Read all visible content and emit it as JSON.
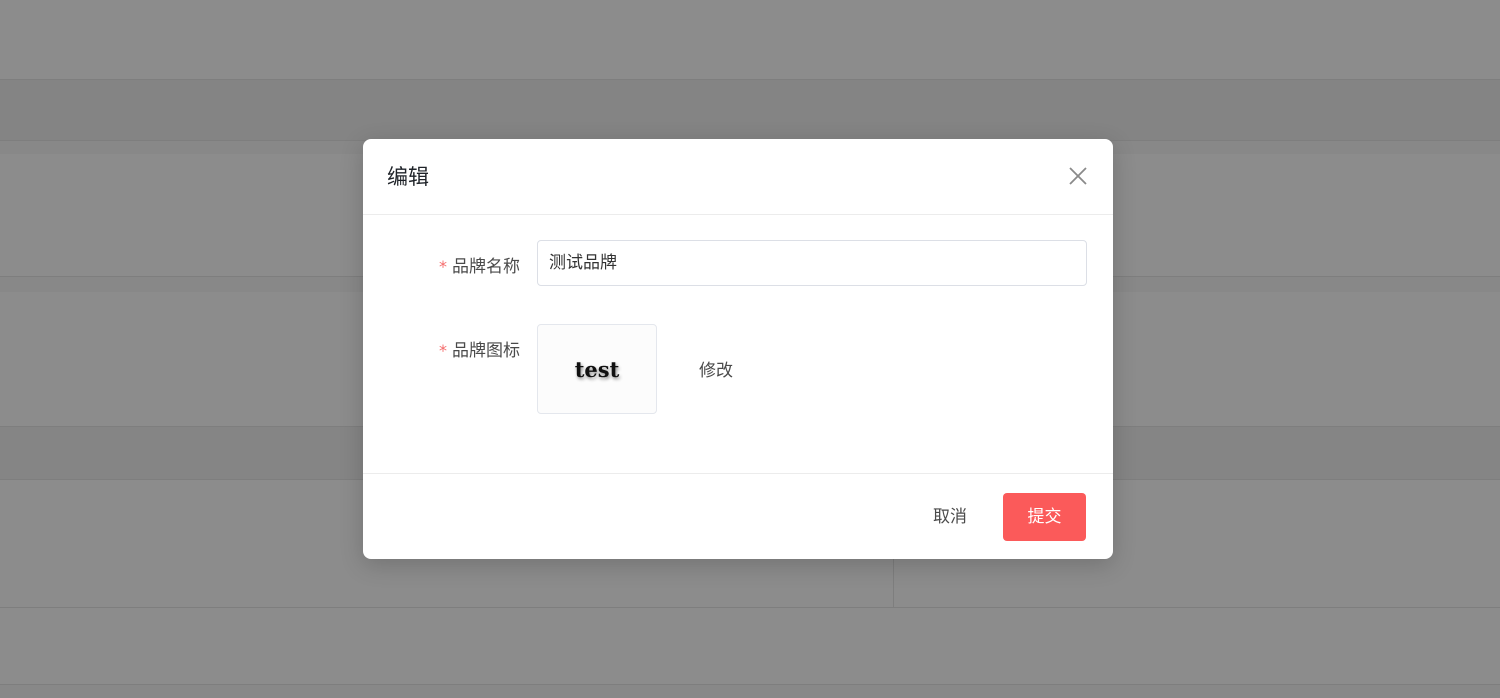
{
  "dialog": {
    "title": "编辑",
    "close_icon": "close-icon"
  },
  "form": {
    "brand_name": {
      "required_mark": "*",
      "label": "品牌名称",
      "value": "测试品牌"
    },
    "brand_icon": {
      "required_mark": "*",
      "label": "品牌图标",
      "logo_text": "test",
      "edit_label": "修改"
    }
  },
  "footer": {
    "cancel_label": "取消",
    "submit_label": "提交"
  },
  "colors": {
    "accent": "#fb5a5a",
    "required": "#f56c6c"
  }
}
